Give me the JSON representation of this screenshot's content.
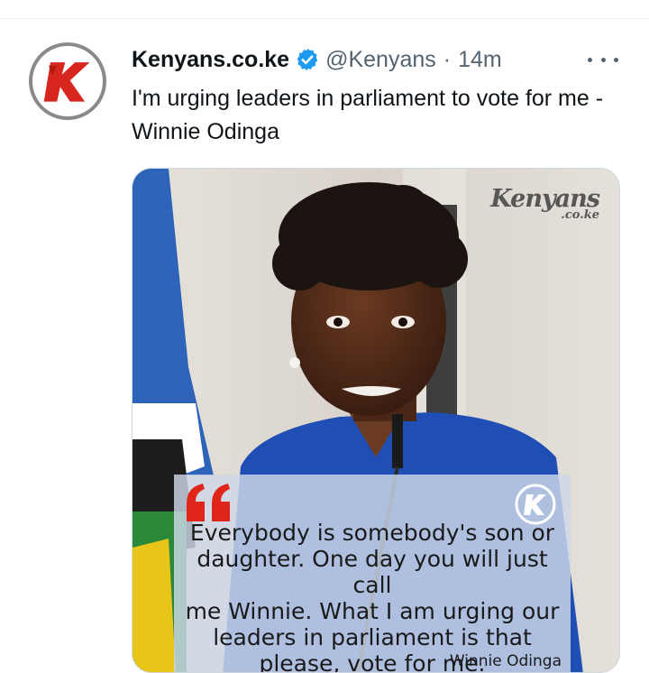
{
  "tweet": {
    "author": {
      "display_name": "Kenyans.co.ke",
      "handle": "@Kenyans",
      "verified": true,
      "avatar_icon": "kenyans-k-logo-icon"
    },
    "separator": "·",
    "timestamp": "14m",
    "text": "I'm urging leaders in parliament to vote for me - Winnie Odinga",
    "more_icon": "more-horizontal-icon",
    "media": {
      "watermark_main": "Kenyans",
      "watermark_sub": ".co.ke",
      "quote_icon": "quotation-mark-icon",
      "quote_text": "Everybody is somebody's son or\ndaughter. One day you will just call\nme Winnie. What I am urging our\nleaders in parliament is that\nplease, vote for me.",
      "quote_author": "Winnie Odinga"
    }
  },
  "colors": {
    "verified_blue": "#1d9bf0",
    "quote_red": "#e0261b",
    "logo_red": "#d7261e",
    "muted_text": "#536471"
  }
}
